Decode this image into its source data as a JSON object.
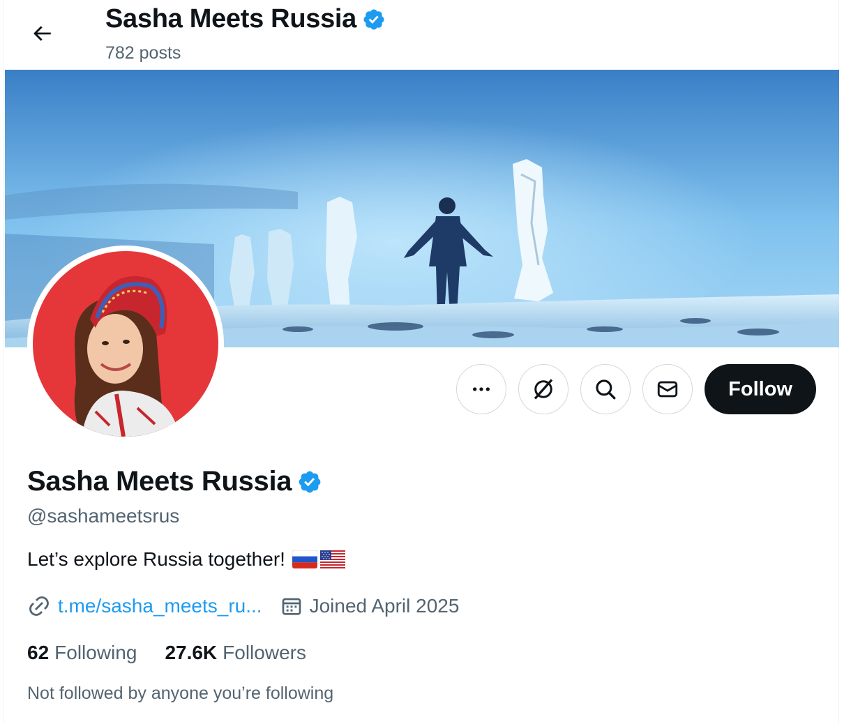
{
  "header": {
    "display_name": "Sasha Meets Russia",
    "posts_count": "782 posts"
  },
  "icons": {
    "back": "arrow-left-icon",
    "verified": "verified-badge-icon",
    "more": "more-dots-icon",
    "grok": "grok-icon",
    "search": "search-icon",
    "message": "envelope-icon",
    "link": "link-icon",
    "calendar": "calendar-icon"
  },
  "actions": {
    "follow_label": "Follow"
  },
  "profile": {
    "display_name": "Sasha Meets Russia",
    "handle": "@sashameetsrus",
    "bio": "Let’s explore Russia together!",
    "link_text": "t.me/sasha_meets_ru...",
    "joined": "Joined April 2025",
    "following_count": "62",
    "following_label": "Following",
    "followers_count": "27.6K",
    "followers_label": "Followers",
    "followed_by_note": "Not followed by anyone you’re following"
  },
  "colors": {
    "accent": "#1d9bf0",
    "text_primary": "#0f1419",
    "text_secondary": "#536471",
    "follow_bg": "#0f1419",
    "avatar_bg": "#e5373a"
  }
}
